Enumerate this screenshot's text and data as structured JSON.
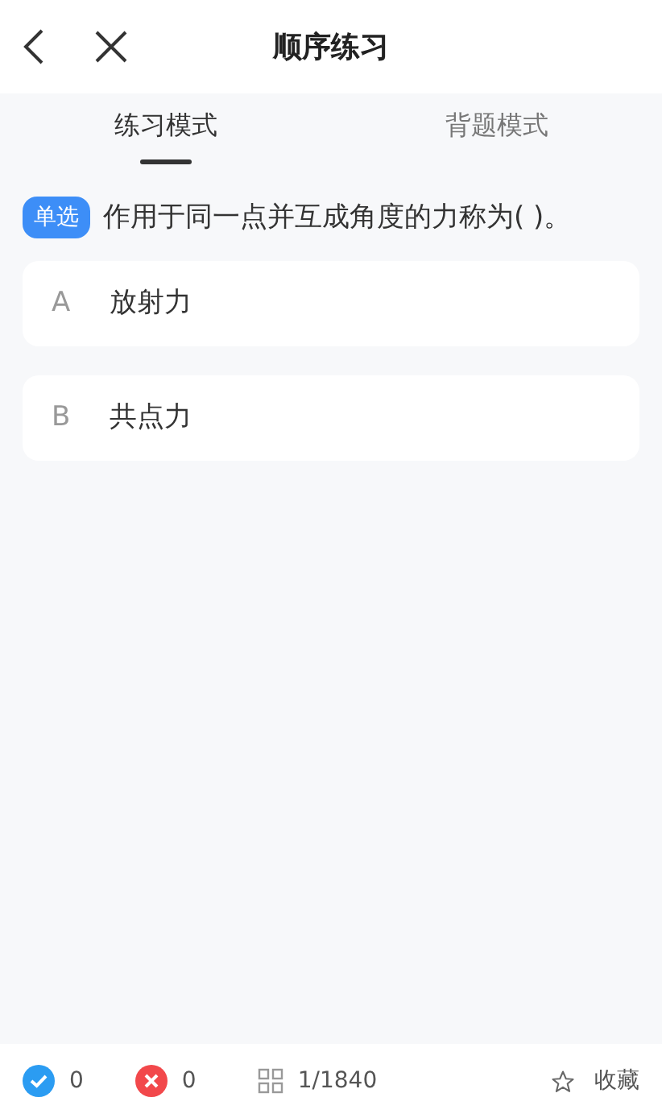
{
  "header": {
    "title": "顺序练习"
  },
  "tabs": [
    {
      "label": "练习模式",
      "selected": true
    },
    {
      "label": "背题模式",
      "selected": false
    }
  ],
  "question": {
    "type_badge": "单选",
    "text": "作用于同一点并互成角度的力称为( )。"
  },
  "options": [
    {
      "letter": "A",
      "text": "放射力"
    },
    {
      "letter": "B",
      "text": "共点力"
    }
  ],
  "footer": {
    "correct_count": "0",
    "wrong_count": "0",
    "progress": "1/1840",
    "favorite_label": "收藏"
  }
}
